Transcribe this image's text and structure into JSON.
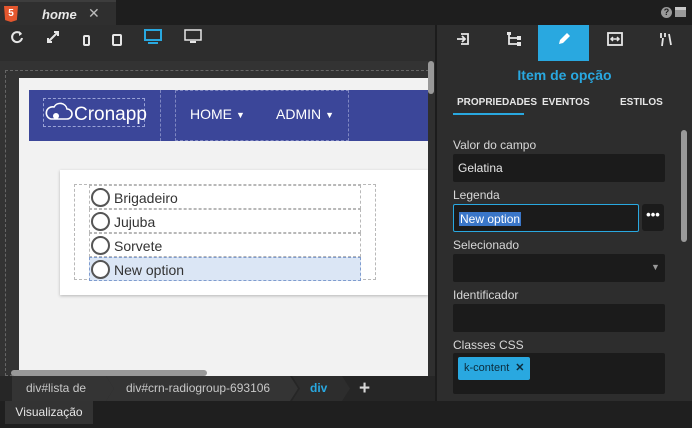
{
  "tab": {
    "badge": "5",
    "title": "home",
    "close": "✕"
  },
  "window": {
    "help_icon": "?"
  },
  "toolbar": {
    "icons": [
      "refresh-icon",
      "expand-icon",
      "phone-icon",
      "tablet-icon",
      "desktop-icon",
      "monitor-icon"
    ]
  },
  "preview": {
    "brand": "Cronapp",
    "nav": [
      {
        "label": "HOME",
        "caret": "▼"
      },
      {
        "label": "ADMIN",
        "caret": "▼"
      }
    ],
    "options": [
      {
        "label": "Brigadeiro",
        "selected": false
      },
      {
        "label": "Jujuba",
        "selected": false
      },
      {
        "label": "Sorvete",
        "selected": false
      },
      {
        "label": "New option",
        "selected": true
      }
    ]
  },
  "breadcrumb": {
    "items": [
      "div#lista de",
      "div#crn-radiogroup-693106",
      "div"
    ],
    "add": "+"
  },
  "bottom": {
    "tab": "Visualização"
  },
  "panel": {
    "title": "Item de opção",
    "subtabs": [
      "PROPRIEDADES",
      "EVENTOS",
      "ESTILOS"
    ],
    "fields": {
      "valor_label": "Valor do campo",
      "valor_value": "Gelatina",
      "legenda_label": "Legenda",
      "legenda_value": "New option",
      "legenda_button": "•••",
      "selecionado_label": "Selecionado",
      "selecionado_value": "",
      "identificador_label": "Identificador",
      "identificador_value": "",
      "classes_label": "Classes CSS",
      "class_chip": "k-content",
      "class_chip_remove": "✕"
    }
  },
  "colors": {
    "accent": "#29a8e0",
    "navbar": "#3b4699"
  }
}
